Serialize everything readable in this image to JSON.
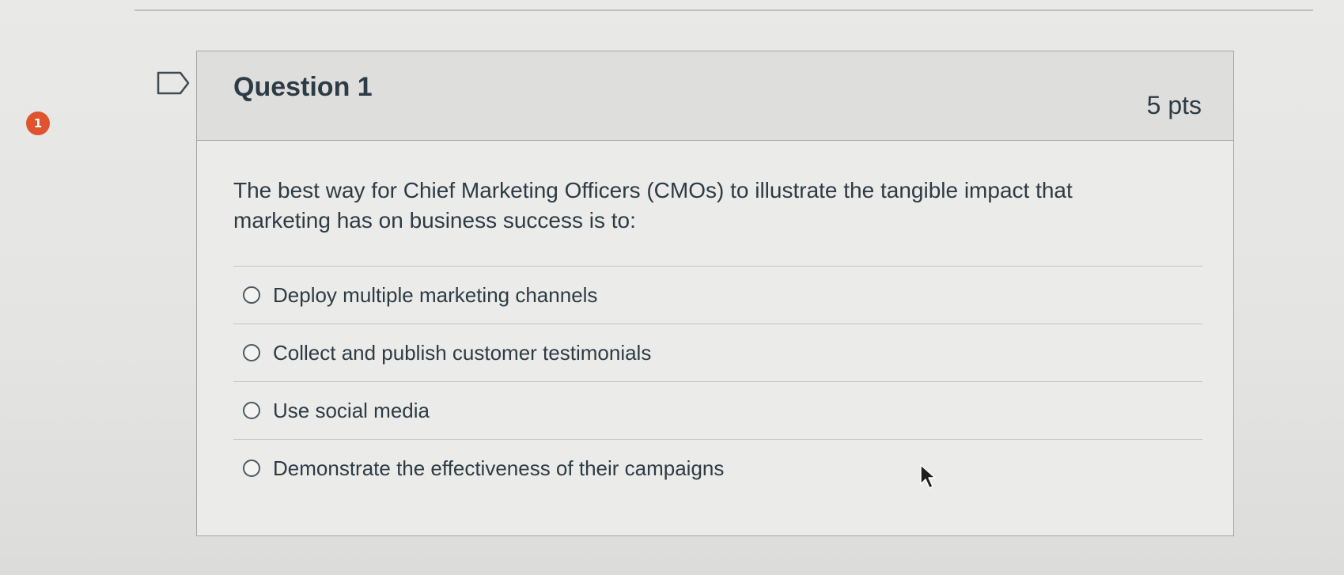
{
  "question": {
    "number_badge": "1",
    "title": "Question 1",
    "points": "5 pts",
    "text": "The best way for Chief Marketing Officers (CMOs) to illustrate the tangible impact that marketing has on business success is to:",
    "answers": [
      {
        "label": "Deploy multiple marketing channels",
        "selected": false
      },
      {
        "label": "Collect and publish customer testimonials",
        "selected": false
      },
      {
        "label": "Use social media",
        "selected": false
      },
      {
        "label": "Demonstrate the effectiveness of their campaigns",
        "selected": false
      }
    ]
  },
  "icons": {
    "badge": "unanswered-number-badge",
    "flag": "flag-question-icon",
    "cursor": "mouse-pointer-icon"
  },
  "colors": {
    "badge": "#e0532f",
    "text": "#2d3b45",
    "header_bg": "#dededc",
    "border": "#a7a7a5"
  }
}
